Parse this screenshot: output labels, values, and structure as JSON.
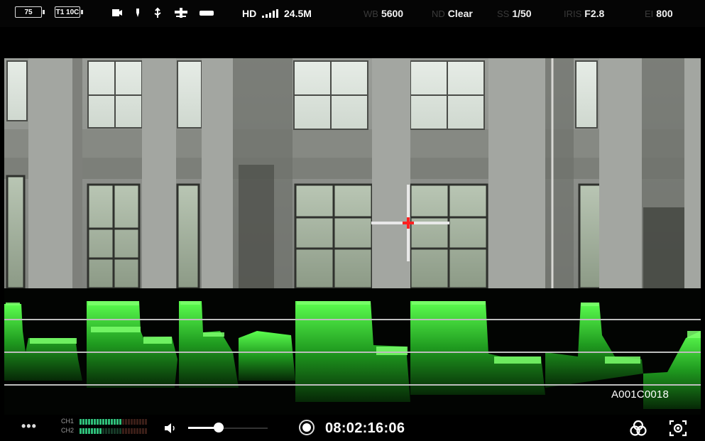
{
  "status": {
    "battery1": "75",
    "battery2": "T1 10C",
    "hd_label": "HD",
    "bitrate": "24.5M",
    "wb_label": "WB",
    "wb_value": "5600",
    "nd_label": "ND",
    "nd_value": "Clear",
    "ss_label": "SS",
    "ss_value": "1/50",
    "iris_label": "IRIS",
    "iris_value": "F2.8",
    "ei_label": "EI",
    "ei_value": "800",
    "icons": [
      "camera-icon",
      "microphone-icon",
      "usb-icon",
      "tripod-icon",
      "hdmi-icon"
    ]
  },
  "waveform": {
    "clip_name": "A001C0018",
    "color": "#39e83a"
  },
  "bottom": {
    "more_label": "•••",
    "ch1_label": "CH1",
    "ch2_label": "CH2",
    "ch1_level": 0.62,
    "ch2_level": 0.32,
    "volume_level": 0.38,
    "timecode": "08:02:16:06",
    "icons": [
      "color-channels-icon",
      "focus-assist-icon"
    ]
  },
  "accent": "#ff2020"
}
